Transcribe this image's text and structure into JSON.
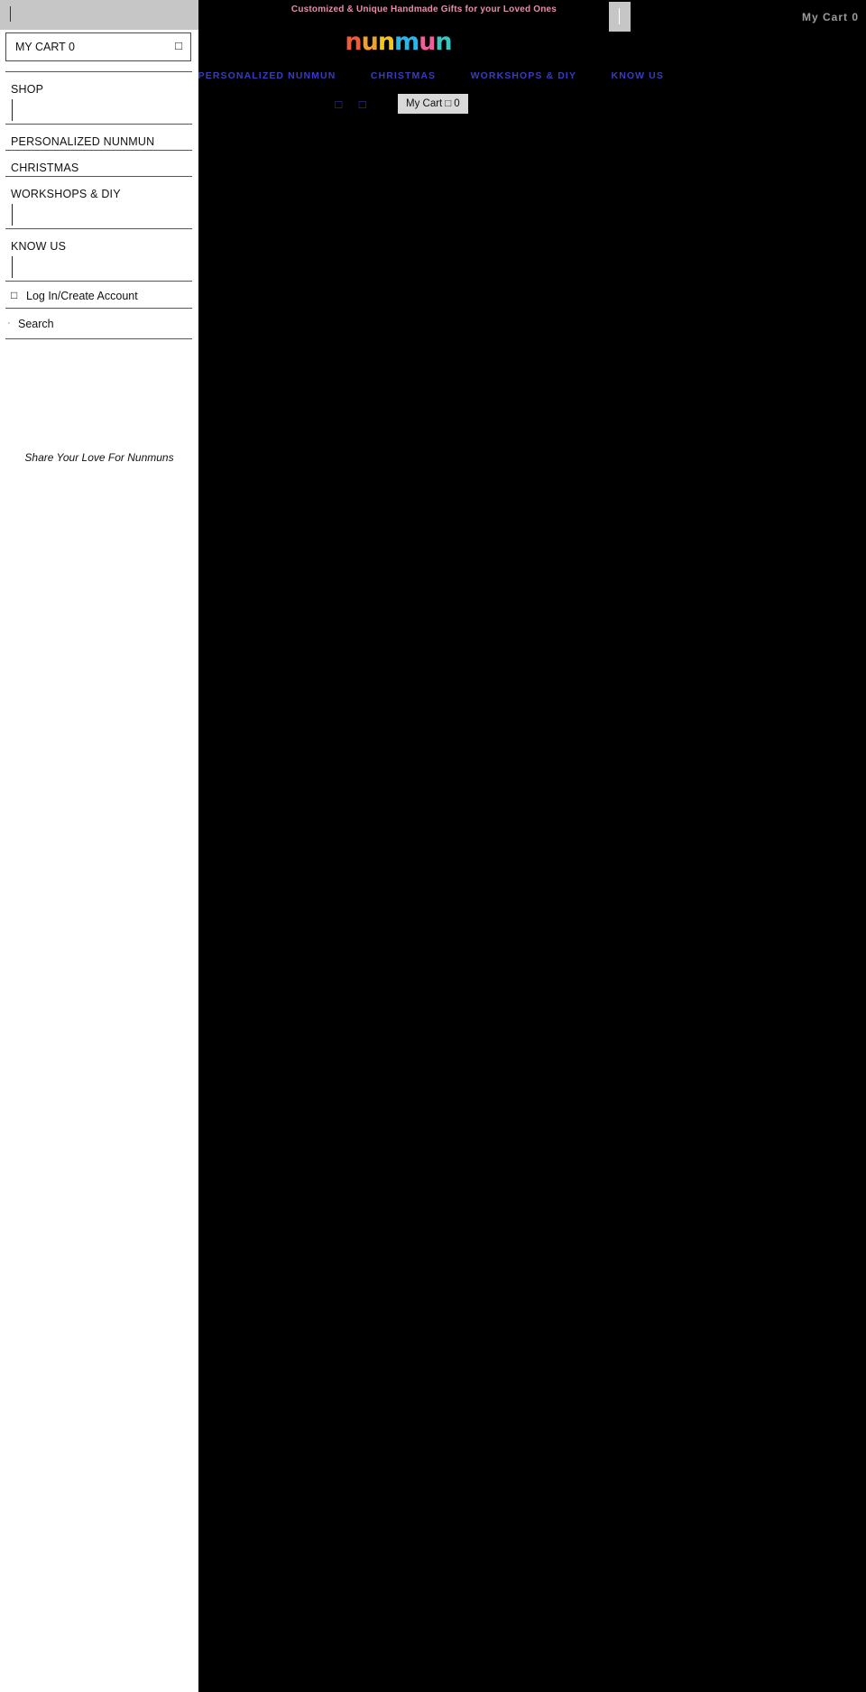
{
  "site": {
    "announcement": "Customized & Unique Handmade Gifts  for your Loved Ones",
    "header_cart_label": "My Cart 0",
    "logo": {
      "letters": [
        {
          "char": "n",
          "color": "#f05a3c"
        },
        {
          "char": "u",
          "color": "#f0a030"
        },
        {
          "char": "n",
          "color": "#f5c518"
        },
        {
          "char": "m",
          "color": "#29b6e8"
        },
        {
          "char": "u",
          "color": "#ef5f9b"
        },
        {
          "char": "n",
          "color": "#38c6c0"
        }
      ],
      "text": "nunmun"
    },
    "nav": [
      {
        "label": "SHOP"
      },
      {
        "label": "PERSONALIZED NUNMUN"
      },
      {
        "label": "CHRISTMAS"
      },
      {
        "label": "WORKSHOPS & DIY"
      },
      {
        "label": "KNOW US"
      }
    ],
    "icons": [
      {
        "name": "user-icon",
        "glyph": "□"
      },
      {
        "name": "search-icon",
        "glyph": "□"
      }
    ],
    "cart_chip": {
      "label": "My Cart",
      "bag_glyph": "□",
      "count": "0"
    },
    "colors": {
      "background": "#000000",
      "nav_link": "#3b3bbf",
      "announcement": "#e58fa8",
      "chip_bg": "#d9d9d9"
    }
  },
  "drawer": {
    "cart": {
      "label": "MY CART 0",
      "bag_glyph": "□"
    },
    "menu": [
      {
        "label": "SHOP",
        "expandable": true
      },
      {
        "label": "PERSONALIZED NUNMUN",
        "expandable": false
      },
      {
        "label": "CHRISTMAS",
        "expandable": false
      },
      {
        "label": "WORKSHOPS & DIY",
        "expandable": true
      },
      {
        "label": "KNOW US",
        "expandable": true
      }
    ],
    "account": {
      "label": "Log In/Create Account",
      "glyph": "□"
    },
    "search": {
      "label": "Search",
      "glyph": "·"
    },
    "tagline": "Share Your Love For Nunmuns"
  }
}
